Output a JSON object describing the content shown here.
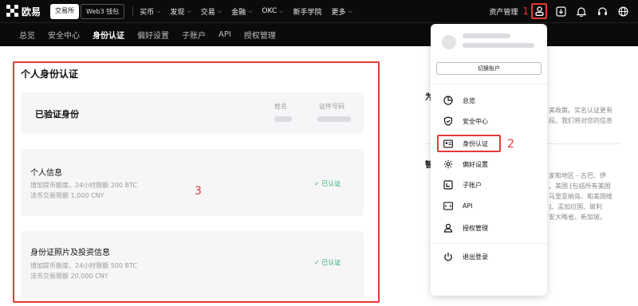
{
  "brand": {
    "name": "欧易"
  },
  "topbar": {
    "segment": [
      "交易所",
      "Web3 钱包"
    ],
    "menu": [
      "买币",
      "发现",
      "交易",
      "金融",
      "OKC",
      "新手学院",
      "更多"
    ],
    "asset": "资产管理",
    "annotation": "1"
  },
  "subnav": [
    "总览",
    "安全中心",
    "身份认证",
    "偏好设置",
    "子账户",
    "API",
    "授权管理"
  ],
  "main": {
    "title": "个人身份认证",
    "verified": {
      "title": "已验证身份",
      "name_label": "姓名",
      "id_label": "证件号码"
    },
    "personal_info": {
      "title": "个人信息",
      "line1": "增加提币额度，24小时限额 200 BTC",
      "line2": "法币交易限额 1,000 CNY",
      "status": "已认证"
    },
    "id_photo": {
      "title": "身份证照片及投资信息",
      "line1": "增加提币额度，24小时限额 500 BTC",
      "line2": "法币交易限额 20,000 CNY",
      "status": "已认证"
    },
    "annotation": "3"
  },
  "background_right": {
    "head1": "为",
    "head2": "智",
    "text_a": [
      "美政策。实名认证更有",
      "段。我们将对您的信息"
    ],
    "text_b": [
      "家和地区 - 古巴、伊",
      "、美国 [包括所有美国",
      "马里亚纳岛、和美国维",
      "]、孟加拉国、玻利",
      "安大略省、新加坡。"
    ]
  },
  "dropdown": {
    "switch": "切换账户",
    "items": [
      "总览",
      "安全中心",
      "身份认证",
      "偏好设置",
      "子账户",
      "API",
      "授权管理"
    ],
    "logout": "退出登录",
    "annotation": "2"
  }
}
